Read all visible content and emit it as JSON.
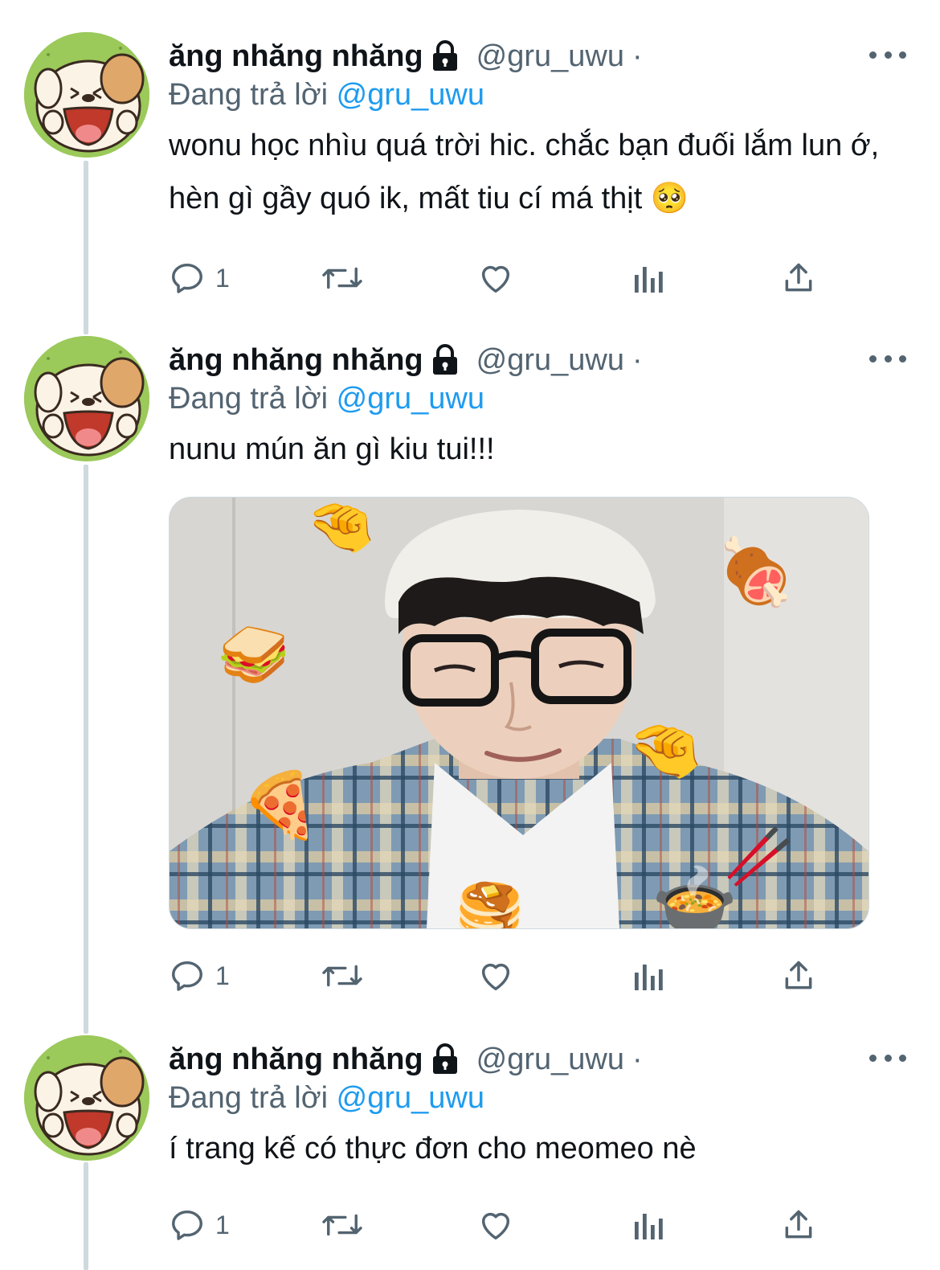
{
  "tweets": [
    {
      "name": "ăng nhăng nhăng",
      "handle": "@gru_uwu",
      "separator": "·",
      "reply_prefix": "Đang trả lời",
      "reply_to": "@gru_uwu",
      "text": "wonu học nhìu quá trời hic. chắc bạn đuối lắm lun ớ, hèn gì gầy quó ik, mất tiu cí má thịt 🥺",
      "reply_count": "1",
      "has_media": false
    },
    {
      "name": "ăng nhăng nhăng",
      "handle": "@gru_uwu",
      "separator": "·",
      "reply_prefix": "Đang trả lời",
      "reply_to": "@gru_uwu",
      "text": "nunu mún ăn gì kiu tui!!!",
      "reply_count": "1",
      "has_media": true,
      "media_emojis": [
        "🤏",
        "🍖",
        "🥪",
        "🤏",
        "🍕",
        "🥞",
        "🍲",
        "🥢"
      ]
    },
    {
      "name": "ăng nhăng nhăng",
      "handle": "@gru_uwu",
      "separator": "·",
      "reply_prefix": "Đang trả lời",
      "reply_to": "@gru_uwu",
      "text": "í trang kế có thực đơn cho meomeo nè",
      "reply_count": "1",
      "has_media": false
    }
  ],
  "colors": {
    "accent": "#1d9bf0",
    "secondary_text": "#536471",
    "thread_line": "#cfd9de",
    "avatar_bg": "#9bc95a"
  },
  "icons": [
    "lock-icon",
    "more-icon",
    "reply-icon",
    "retweet-icon",
    "like-icon",
    "analytics-icon",
    "share-icon"
  ]
}
